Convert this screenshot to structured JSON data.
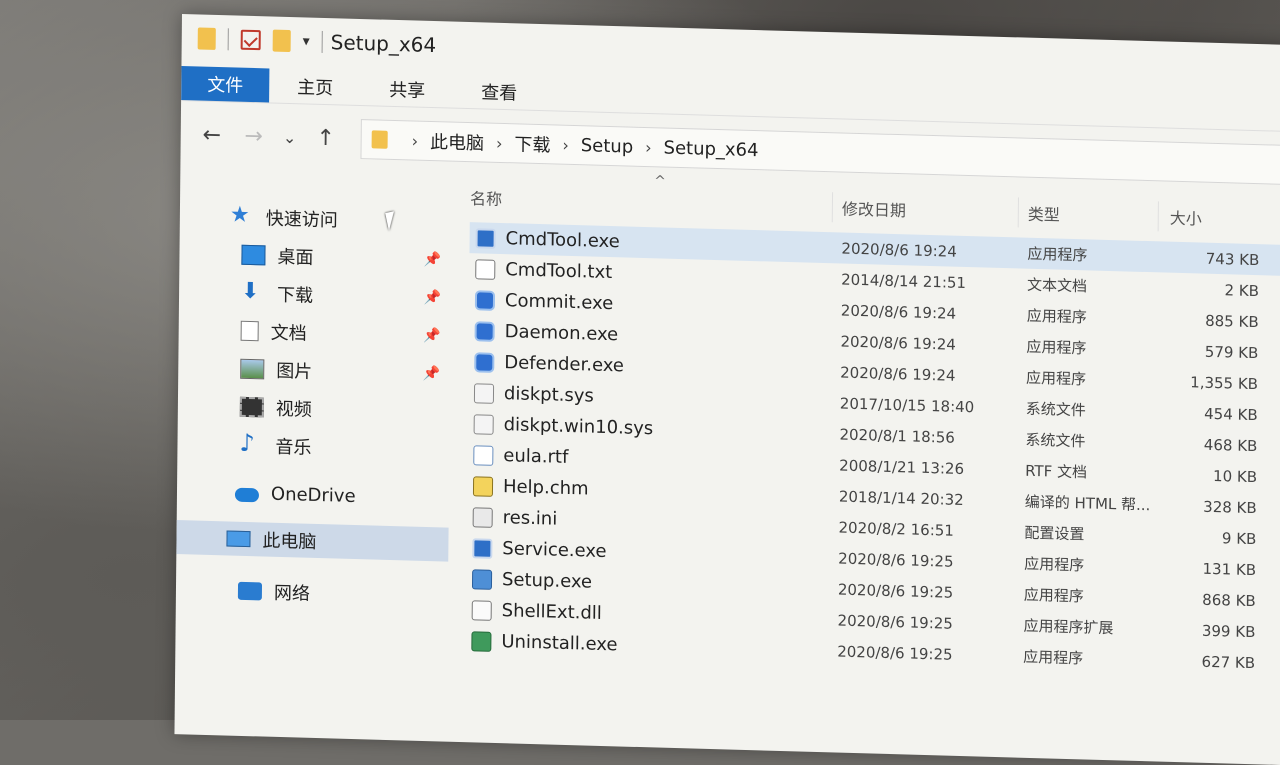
{
  "window": {
    "title": "Setup_x64"
  },
  "quick_access_toolbar": {
    "icons": [
      "folder-icon",
      "properties-check-icon",
      "new-folder-icon",
      "customize-dropdown-icon"
    ]
  },
  "ribbon": {
    "tabs": [
      "文件",
      "主页",
      "共享",
      "查看"
    ]
  },
  "navigation": {
    "back": "←",
    "forward": "→",
    "recent": "⌄",
    "up": "↑",
    "breadcrumb": [
      "此电脑",
      "下载",
      "Setup",
      "Setup_x64"
    ],
    "breadcrumb_sep": "›"
  },
  "nav_pane": {
    "quick_access_label": "快速访问",
    "items": [
      {
        "label": "桌面",
        "icon": "desktop-icon",
        "pinned": true
      },
      {
        "label": "下载",
        "icon": "download-icon",
        "pinned": true
      },
      {
        "label": "文档",
        "icon": "documents-icon",
        "pinned": true
      },
      {
        "label": "图片",
        "icon": "pictures-icon",
        "pinned": true
      },
      {
        "label": "视频",
        "icon": "videos-icon",
        "pinned": false
      },
      {
        "label": "音乐",
        "icon": "music-icon",
        "pinned": false
      }
    ],
    "onedrive_label": "OneDrive",
    "this_pc_label": "此电脑",
    "network_label": "网络",
    "pin_glyph": "📌"
  },
  "file_list": {
    "sort_caret": "^",
    "columns": {
      "name": "名称",
      "date": "修改日期",
      "type": "类型",
      "size": "大小"
    },
    "rows": [
      {
        "name": "CmdTool.exe",
        "date": "2020/8/6 19:24",
        "type": "应用程序",
        "size": "743 KB",
        "icon": "exe"
      },
      {
        "name": "CmdTool.txt",
        "date": "2014/8/14 21:51",
        "type": "文本文档",
        "size": "2 KB",
        "icon": "txt"
      },
      {
        "name": "Commit.exe",
        "date": "2020/8/6 19:24",
        "type": "应用程序",
        "size": "885 KB",
        "icon": "shield"
      },
      {
        "name": "Daemon.exe",
        "date": "2020/8/6 19:24",
        "type": "应用程序",
        "size": "579 KB",
        "icon": "shield"
      },
      {
        "name": "Defender.exe",
        "date": "2020/8/6 19:24",
        "type": "应用程序",
        "size": "1,355 KB",
        "icon": "shield"
      },
      {
        "name": "diskpt.sys",
        "date": "2017/10/15 18:40",
        "type": "系统文件",
        "size": "454 KB",
        "icon": "sys"
      },
      {
        "name": "diskpt.win10.sys",
        "date": "2020/8/1 18:56",
        "type": "系统文件",
        "size": "468 KB",
        "icon": "sys"
      },
      {
        "name": "eula.rtf",
        "date": "2008/1/21 13:26",
        "type": "RTF 文档",
        "size": "10 KB",
        "icon": "rtf"
      },
      {
        "name": "Help.chm",
        "date": "2018/1/14 20:32",
        "type": "编译的 HTML 帮...",
        "size": "328 KB",
        "icon": "chm"
      },
      {
        "name": "res.ini",
        "date": "2020/8/2 16:51",
        "type": "配置设置",
        "size": "9 KB",
        "icon": "ini"
      },
      {
        "name": "Service.exe",
        "date": "2020/8/6 19:25",
        "type": "应用程序",
        "size": "131 KB",
        "icon": "exe"
      },
      {
        "name": "Setup.exe",
        "date": "2020/8/6 19:25",
        "type": "应用程序",
        "size": "868 KB",
        "icon": "setup"
      },
      {
        "name": "ShellExt.dll",
        "date": "2020/8/6 19:25",
        "type": "应用程序扩展",
        "size": "399 KB",
        "icon": "dll"
      },
      {
        "name": "Uninstall.exe",
        "date": "2020/8/6 19:25",
        "type": "应用程序",
        "size": "627 KB",
        "icon": "uninstall"
      }
    ],
    "selected_index": 0
  }
}
